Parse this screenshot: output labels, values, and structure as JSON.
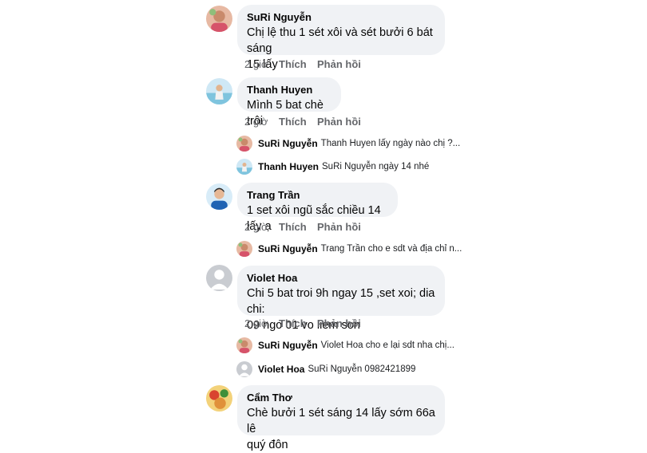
{
  "comments": [
    {
      "author": "SuRi Nguyễn",
      "lines": [
        "Chị lệ thu 1 sét xôi và sét bưởi 6 bát sáng",
        "15 lấy"
      ],
      "time": "2 giờ",
      "like": "Thích",
      "reply": "Phản hồi",
      "avatar_color": "#c98a6b"
    },
    {
      "author": "Thanh Huyen",
      "lines": [
        "Mình 5 bat chè trôi"
      ],
      "time": "2 giờ",
      "like": "Thích",
      "reply": "Phản hồi",
      "avatar_color": "#9fd0e8",
      "replies": [
        {
          "author": "SuRi Nguyễn",
          "text": "Thanh Huyen lấy ngày nào chị ?...",
          "avatar_color": "#c98a6b"
        },
        {
          "author": "Thanh Huyen",
          "text": "SuRi Nguyễn ngày 14 nhé",
          "avatar_color": "#9fd0e8"
        }
      ]
    },
    {
      "author": "Trang Trần",
      "lines": [
        "1 set xôi ngũ sắc chiều 14 lấy ạ"
      ],
      "time": "2 giờ",
      "like": "Thích",
      "reply": "Phản hồi",
      "avatar_color": "#3a7fc4",
      "replies": [
        {
          "author": "SuRi Nguyễn",
          "text": "Trang Trần cho e sdt và địa chỉ n...",
          "avatar_color": "#c98a6b"
        }
      ]
    },
    {
      "author": "Violet Hoa",
      "lines": [
        "Chi 5 bat troi 9h ngay 15 ,set xoi; dia chi:",
        "09 ngo 01 vo liem son"
      ],
      "time": "2 giờ",
      "like": "Thích",
      "reply": "Phản hồi",
      "avatar_color": "#c9ccd1",
      "replies": [
        {
          "author": "SuRi Nguyễn",
          "text": "Violet Hoa cho e lại sdt nha chị...",
          "avatar_color": "#c98a6b"
        },
        {
          "author": "Violet Hoa",
          "text": "SuRi Nguyễn 0982421899",
          "avatar_color": "#c9ccd1"
        }
      ]
    },
    {
      "author": "Cẩm Thơ",
      "lines": [
        "Chè bưởi 1 sét sáng 14 lấy sớm 66a lê",
        "quý đôn"
      ],
      "avatar_color": "#e0913a"
    }
  ]
}
